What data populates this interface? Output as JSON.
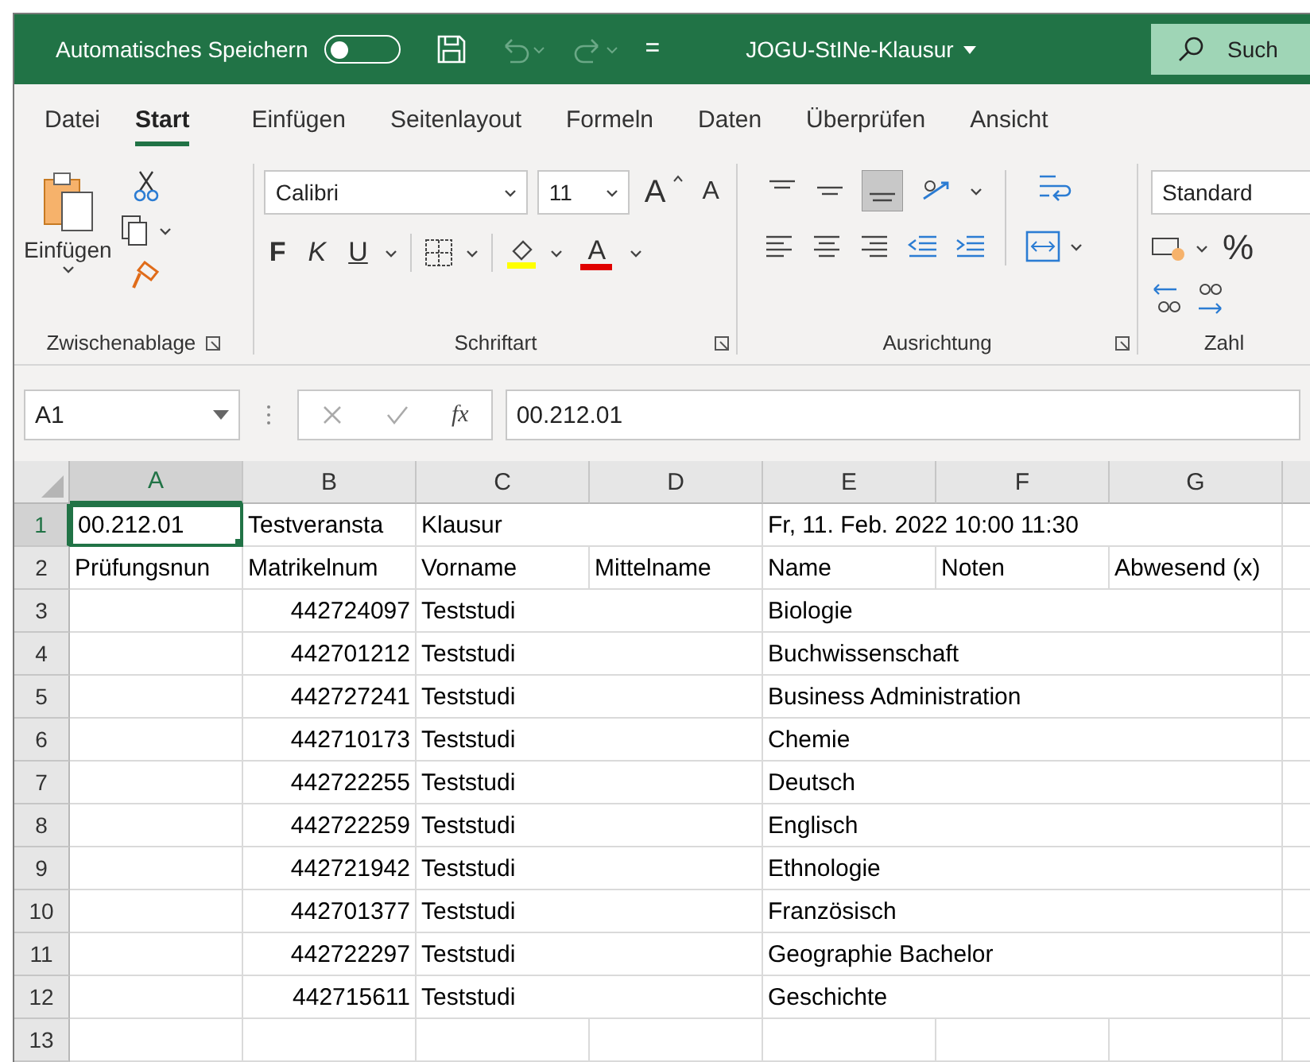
{
  "title_bar": {
    "autosave_label": "Automatisches Speichern",
    "autosave_on": false,
    "qat_caret": "=",
    "document_title": "JOGU-StINe-Klausur",
    "search_placeholder": "Such"
  },
  "ribbon_tabs": [
    {
      "label": "Datei",
      "selected": false
    },
    {
      "label": "Start",
      "selected": true
    },
    {
      "label": "Einfügen",
      "selected": false
    },
    {
      "label": "Seitenlayout",
      "selected": false
    },
    {
      "label": "Formeln",
      "selected": false
    },
    {
      "label": "Daten",
      "selected": false
    },
    {
      "label": "Überprüfen",
      "selected": false
    },
    {
      "label": "Ansicht",
      "selected": false
    }
  ],
  "ribbon": {
    "clipboard": {
      "paste_label": "Einfügen",
      "group": "Zwischenablage"
    },
    "font": {
      "font_name": "Calibri",
      "font_size": "11",
      "grow": "A",
      "shrink": "A",
      "bold": "F",
      "italic": "K",
      "underline": "U",
      "font_color": "A",
      "group": "Schriftart"
    },
    "alignment": {
      "group": "Ausrichtung"
    },
    "number": {
      "format": "Standard",
      "percent": "%",
      "group": "Zahl"
    }
  },
  "formula_bar": {
    "name_box": "A1",
    "function_label": "fx",
    "value": "00.212.01"
  },
  "sheet": {
    "columns": [
      {
        "label": "A",
        "selected": true
      },
      {
        "label": "B",
        "selected": false
      },
      {
        "label": "C",
        "selected": false
      },
      {
        "label": "D",
        "selected": false
      },
      {
        "label": "E",
        "selected": false
      },
      {
        "label": "F",
        "selected": false
      },
      {
        "label": "G",
        "selected": false
      }
    ],
    "rows": [
      {
        "label": "1",
        "selected": true,
        "cells": [
          "00.212.01",
          "Testveransta",
          "Klausur",
          null,
          "Fr, 11. Feb. 2022 10:00 11:30",
          null,
          null
        ]
      },
      {
        "label": "2",
        "selected": false,
        "cells": [
          "Prüfungsnun",
          "Matrikelnum",
          "Vorname",
          "Mittelname",
          "Name",
          "Noten",
          "Abwesend (x)"
        ]
      },
      {
        "label": "3",
        "selected": false,
        "cells": [
          null,
          {
            "text": "442724097",
            "kind": "number"
          },
          "Teststudi",
          null,
          "Biologie",
          null,
          null
        ]
      },
      {
        "label": "4",
        "selected": false,
        "cells": [
          null,
          {
            "text": "442701212",
            "kind": "number"
          },
          "Teststudi",
          null,
          "Buchwissenschaft",
          null,
          null
        ]
      },
      {
        "label": "5",
        "selected": false,
        "cells": [
          null,
          {
            "text": "442727241",
            "kind": "number"
          },
          "Teststudi",
          null,
          "Business Administration",
          null,
          null
        ]
      },
      {
        "label": "6",
        "selected": false,
        "cells": [
          null,
          {
            "text": "442710173",
            "kind": "number"
          },
          "Teststudi",
          null,
          "Chemie",
          null,
          null
        ]
      },
      {
        "label": "7",
        "selected": false,
        "cells": [
          null,
          {
            "text": "442722255",
            "kind": "number"
          },
          "Teststudi",
          null,
          "Deutsch",
          null,
          null
        ]
      },
      {
        "label": "8",
        "selected": false,
        "cells": [
          null,
          {
            "text": "442722259",
            "kind": "number"
          },
          "Teststudi",
          null,
          "Englisch",
          null,
          null
        ]
      },
      {
        "label": "9",
        "selected": false,
        "cells": [
          null,
          {
            "text": "442721942",
            "kind": "number"
          },
          "Teststudi",
          null,
          "Ethnologie",
          null,
          null
        ]
      },
      {
        "label": "10",
        "selected": false,
        "cells": [
          null,
          {
            "text": "442701377",
            "kind": "number"
          },
          "Teststudi",
          null,
          "Französisch",
          null,
          null
        ]
      },
      {
        "label": "11",
        "selected": false,
        "cells": [
          null,
          {
            "text": "442722297",
            "kind": "number"
          },
          "Teststudi",
          null,
          "Geographie Bachelor",
          null,
          null
        ]
      },
      {
        "label": "12",
        "selected": false,
        "cells": [
          null,
          {
            "text": "442715611",
            "kind": "number"
          },
          "Teststudi",
          null,
          "Geschichte",
          null,
          null
        ]
      },
      {
        "label": "13",
        "selected": false,
        "cells": [
          null,
          null,
          null,
          null,
          null,
          null,
          null
        ]
      }
    ]
  }
}
